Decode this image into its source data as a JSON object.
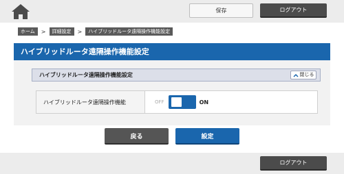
{
  "header": {
    "home_icon": "home-icon",
    "save_label": "保存",
    "logout_label": "ログアウト"
  },
  "breadcrumb": {
    "items": [
      "ホーム",
      "詳細設定",
      "ハイブリッドルータ遠隔操作機能設定"
    ],
    "separator": ">"
  },
  "page": {
    "title": "ハイブリッドルータ遠隔操作機能設定"
  },
  "section": {
    "title": "ハイブリッドルータ遠隔操作機能設定",
    "collapse_label": "閉じる",
    "collapse_icon": "chevron-up-icon"
  },
  "setting": {
    "label": "ハイブリッドルータ遠隔操作機能",
    "off_label": "OFF",
    "on_label": "ON",
    "state": "ON"
  },
  "actions": {
    "back_label": "戻る",
    "apply_label": "設定"
  },
  "footer": {
    "logout_label": "ログアウト"
  },
  "colors": {
    "accent": "#1a66ad",
    "dark_button": "#4b4b4b",
    "bar_background": "#ececec",
    "panel_background": "#f2f2f2",
    "section_header": "#dcdfe9"
  }
}
